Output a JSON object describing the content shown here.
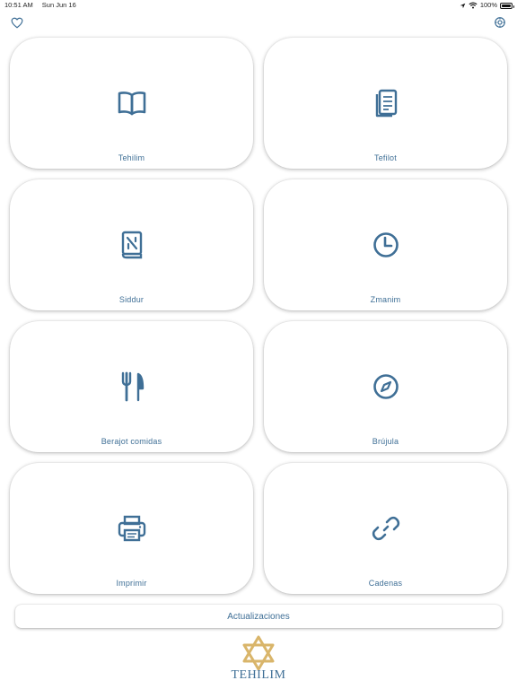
{
  "status_bar": {
    "time": "10:51 AM",
    "date": "Sun Jun 16",
    "battery": "100%"
  },
  "topbar": {
    "left_icon": "heart-icon",
    "right_icon": "settings-icon"
  },
  "menu": [
    {
      "label": "Tehilim",
      "icon": "book-open-icon"
    },
    {
      "label": "Tefilot",
      "icon": "document-icon"
    },
    {
      "label": "Siddur",
      "icon": "siddur-book-icon"
    },
    {
      "label": "Zmanim",
      "icon": "clock-icon"
    },
    {
      "label": "Berajot comidas",
      "icon": "fork-knife-icon"
    },
    {
      "label": "Brújula",
      "icon": "compass-icon"
    },
    {
      "label": "Imprimir",
      "icon": "printer-icon"
    },
    {
      "label": "Cadenas",
      "icon": "link-icon"
    }
  ],
  "update_button": "Actualizaciones",
  "logo": {
    "text": "TEHILIM",
    "icon": "star-of-david-icon"
  },
  "colors": {
    "accent": "#3f6f96",
    "gold": "#d9b56a"
  }
}
